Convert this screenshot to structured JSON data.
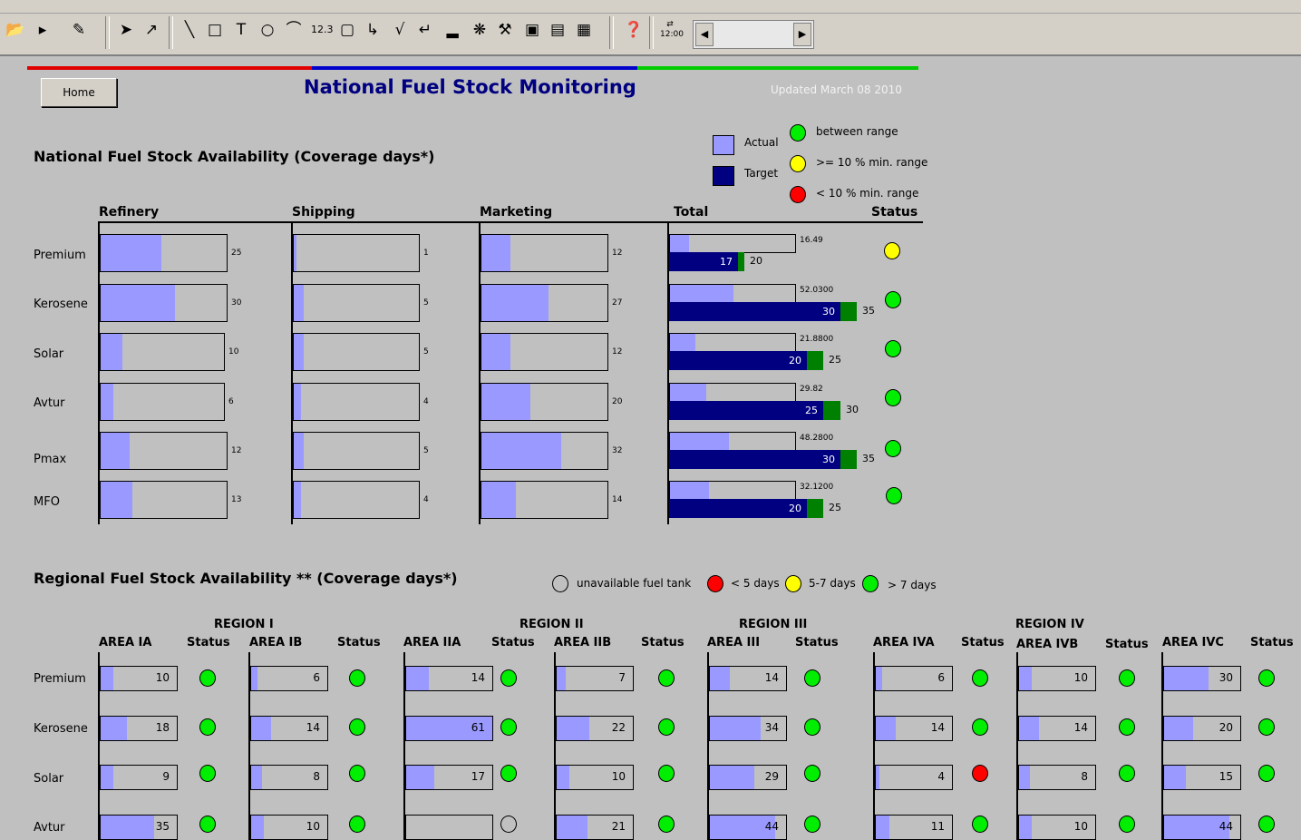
{
  "window": {
    "toolbar_icons": [
      "open-icon",
      "play-icon",
      "edit-chart-icon",
      "pointer-icon",
      "pen-icon",
      "line-icon",
      "rectangle-icon",
      "text-icon",
      "ellipse-icon",
      "arc-icon",
      "number-icon",
      "round-rect-icon",
      "connector-icon",
      "trend-icon",
      "step-icon",
      "bar-chart-icon",
      "wizard-icon",
      "tools-icon",
      "picture-icon",
      "report-icon",
      "grid-icon",
      "help-icon",
      "clock-icon"
    ],
    "clock_label": "12:00"
  },
  "page": {
    "home_label": "Home",
    "title": "National Fuel Stock Monitoring",
    "updated": "Updated March 08 2010",
    "accent": {
      "red": "#e00000",
      "blue": "#0000cc",
      "green": "#00cc00"
    }
  },
  "national": {
    "section_title": "National Fuel Stock Availability (Coverage days*)",
    "legend": {
      "actual": "Actual",
      "target": "Target",
      "between": "between range",
      "ge10": ">= 10 % min. range",
      "lt10": "< 10 % min. range",
      "actual_color": "#9999ff",
      "target_color": "#000080"
    },
    "columns": {
      "refinery": "Refinery",
      "shipping": "Shipping",
      "marketing": "Marketing",
      "total": "Total",
      "status": "Status"
    },
    "rows": [
      {
        "label": "Premium",
        "refinery": "25",
        "refinery_frac": 0.48,
        "shipping": "1",
        "shipping_frac": 0.0,
        "marketing": "12",
        "marketing_frac": 0.23,
        "total_actual": "16.49",
        "total_actual_frac": 0.15,
        "target": "17",
        "target_frac": 0.55,
        "max": "20",
        "max_frac": 0.6,
        "status": "yellow"
      },
      {
        "label": "Kerosene",
        "refinery": "30",
        "refinery_frac": 0.59,
        "shipping": "5",
        "shipping_frac": 0.08,
        "marketing": "27",
        "marketing_frac": 0.53,
        "total_actual": "52.0300",
        "total_actual_frac": 0.51,
        "target": "30",
        "target_frac": 1.37,
        "max": "35",
        "max_frac": 1.5,
        "status": "green"
      },
      {
        "label": "Solar",
        "refinery": "10",
        "refinery_frac": 0.18,
        "shipping": "5",
        "shipping_frac": 0.08,
        "marketing": "12",
        "marketing_frac": 0.23,
        "total_actual": "21.8800",
        "total_actual_frac": 0.2,
        "target": "20",
        "target_frac": 1.1,
        "max": "25",
        "max_frac": 1.23,
        "status": "green"
      },
      {
        "label": "Avtur",
        "refinery": "6",
        "refinery_frac": 0.1,
        "shipping": "4",
        "shipping_frac": 0.06,
        "marketing": "20",
        "marketing_frac": 0.39,
        "total_actual": "29.82",
        "total_actual_frac": 0.29,
        "target": "25",
        "target_frac": 1.23,
        "max": "30",
        "max_frac": 1.37,
        "status": "green"
      },
      {
        "label": "Pmax",
        "refinery": "12",
        "refinery_frac": 0.23,
        "shipping": "5",
        "shipping_frac": 0.08,
        "marketing": "32",
        "marketing_frac": 0.63,
        "total_actual": "48.2800",
        "total_actual_frac": 0.47,
        "target": "30",
        "target_frac": 1.37,
        "max": "35",
        "max_frac": 1.5,
        "status": "green"
      },
      {
        "label": "MFO",
        "refinery": "13",
        "refinery_frac": 0.25,
        "shipping": "4",
        "shipping_frac": 0.06,
        "marketing": "14",
        "marketing_frac": 0.27,
        "total_actual": "32.1200",
        "total_actual_frac": 0.31,
        "target": "20",
        "target_frac": 1.1,
        "max": "25",
        "max_frac": 1.23,
        "status": "green"
      }
    ]
  },
  "regional": {
    "section_title": "Regional Fuel Stock Availability ** (Coverage days*)",
    "legend": {
      "unavailable": "unavailable fuel tank",
      "lt5": "< 5 days",
      "d57": "5-7 days",
      "gt7": "> 7 days"
    },
    "regions": [
      "REGION I",
      "REGION II",
      "REGION III",
      "REGION IV"
    ],
    "status_label": "Status",
    "areas": [
      {
        "name": "AREA IA",
        "values": [
          "10",
          "18",
          "9",
          "35"
        ],
        "fracs": [
          0.17,
          0.35,
          0.17,
          0.7
        ],
        "status": [
          "green",
          "green",
          "green",
          "green"
        ]
      },
      {
        "name": "AREA IB",
        "values": [
          "6",
          "14",
          "8",
          "10"
        ],
        "fracs": [
          0.08,
          0.26,
          0.14,
          0.17
        ],
        "status": [
          "green",
          "green",
          "green",
          "green"
        ]
      },
      {
        "name": "AREA IIA",
        "values": [
          "14",
          "61",
          "17",
          ""
        ],
        "fracs": [
          0.26,
          1.0,
          0.33,
          0.0
        ],
        "status": [
          "green",
          "green",
          "green",
          "white"
        ]
      },
      {
        "name": "AREA IIB",
        "values": [
          "7",
          "22",
          "10",
          "21"
        ],
        "fracs": [
          0.12,
          0.43,
          0.17,
          0.41
        ],
        "status": [
          "green",
          "green",
          "green",
          "green"
        ]
      },
      {
        "name": "AREA III",
        "values": [
          "14",
          "34",
          "29",
          "44"
        ],
        "fracs": [
          0.26,
          0.67,
          0.58,
          0.86
        ],
        "status": [
          "green",
          "green",
          "green",
          "green"
        ]
      },
      {
        "name": "AREA IVA",
        "values": [
          "6",
          "14",
          "4",
          "11"
        ],
        "fracs": [
          0.08,
          0.26,
          0.05,
          0.18
        ],
        "status": [
          "green",
          "green",
          "red",
          "green"
        ]
      },
      {
        "name": "AREA IVB",
        "values": [
          "10",
          "14",
          "8",
          "10"
        ],
        "fracs": [
          0.17,
          0.26,
          0.14,
          0.17
        ],
        "status": [
          "green",
          "green",
          "green",
          "green"
        ]
      },
      {
        "name": "AREA IVC",
        "values": [
          "30",
          "20",
          "15",
          "44"
        ],
        "fracs": [
          0.58,
          0.38,
          0.28,
          0.86
        ],
        "status": [
          "green",
          "green",
          "green",
          "green"
        ]
      }
    ],
    "rows": [
      "Premium",
      "Kerosene",
      "Solar",
      "Avtur"
    ]
  }
}
